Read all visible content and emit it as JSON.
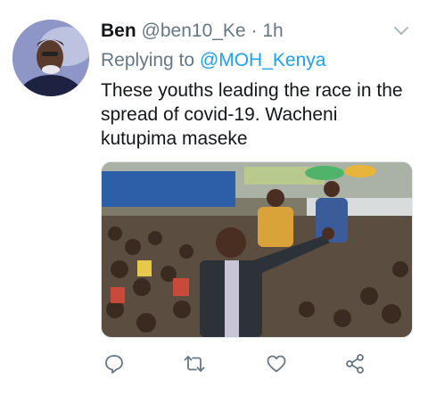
{
  "tweet": {
    "display_name": "Ben",
    "handle": "@ben10_Ke",
    "separator": "·",
    "time": "1h",
    "replying_prefix": "Replying to",
    "replying_handle": "@MOH_Kenya",
    "text": "These youths leading the race in the spread of covid-19. Wacheni kutupima maseke"
  },
  "icons": {
    "menu": "chevron-down-icon",
    "reply": "reply-icon",
    "retweet": "retweet-icon",
    "like": "heart-icon",
    "share": "share-icon"
  },
  "colors": {
    "text": "#14171a",
    "muted": "#657786",
    "link": "#1da1f2"
  }
}
